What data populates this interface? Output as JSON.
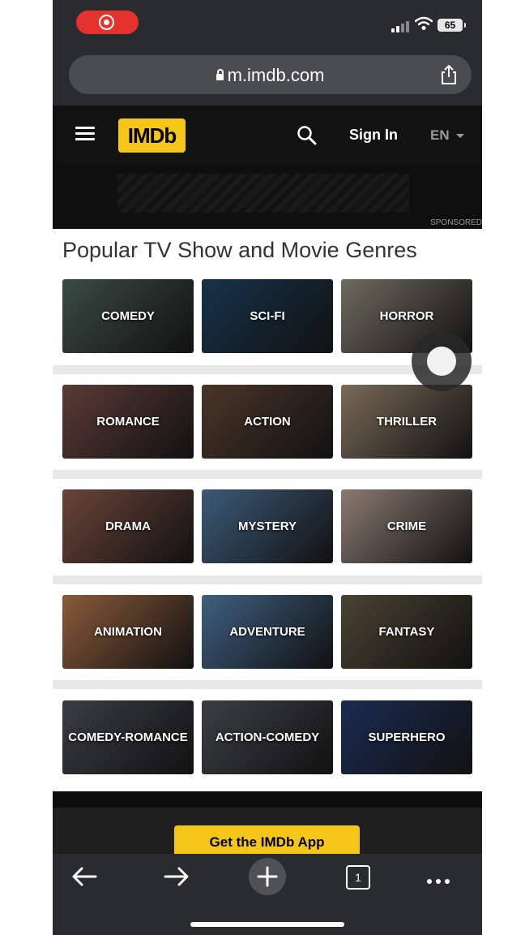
{
  "status": {
    "battery": "65"
  },
  "browser": {
    "url": "m.imdb.com"
  },
  "nav": {
    "logo": "IMDb",
    "signin": "Sign In",
    "lang": "EN"
  },
  "ad": {
    "sponsored": "SPONSORED"
  },
  "page": {
    "heading": "Popular TV Show and Movie Genres"
  },
  "genres": [
    "COMEDY",
    "SCI-FI",
    "HORROR",
    "ROMANCE",
    "ACTION",
    "THRILLER",
    "DRAMA",
    "MYSTERY",
    "CRIME",
    "ANIMATION",
    "ADVENTURE",
    "FANTASY",
    "COMEDY-ROMANCE",
    "ACTION-COMEDY",
    "SUPERHERO"
  ],
  "genre_colors": [
    "#3a4a45",
    "#16324a",
    "#6e6a5e",
    "#5a3a35",
    "#4a3528",
    "#7a6a58",
    "#6a4438",
    "#3d5a78",
    "#8a7a70",
    "#8a5a3a",
    "#3e5f80",
    "#4a4232",
    "#3a3c44",
    "#3c3e44",
    "#1a2a52"
  ],
  "footer": {
    "get_app": "Get the IMDb App"
  },
  "toolbar": {
    "tab_count": "1"
  }
}
